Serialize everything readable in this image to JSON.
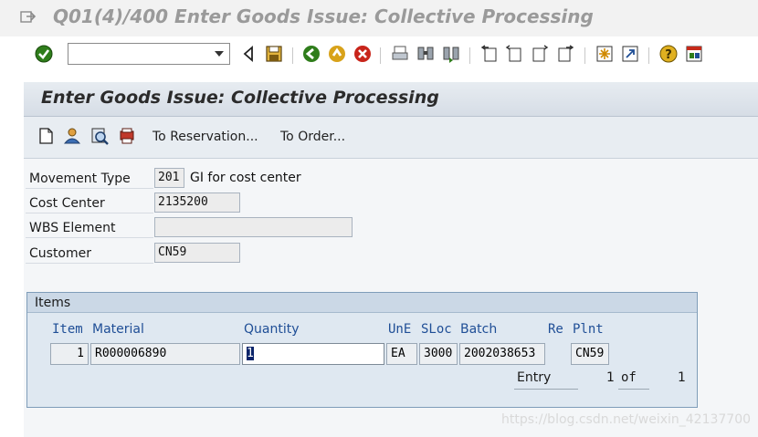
{
  "window": {
    "title": "Q01(4)/400 Enter Goods Issue: Collective Processing"
  },
  "toolbar": {
    "command_field_value": "",
    "buttons": [
      {
        "name": "enter-icon"
      },
      {
        "name": "back-arrow-icon"
      },
      {
        "name": "save-icon"
      },
      {
        "name": "back-icon"
      },
      {
        "name": "exit-icon"
      },
      {
        "name": "cancel-icon"
      },
      {
        "name": "print-icon"
      },
      {
        "name": "find-icon"
      },
      {
        "name": "find-next-icon"
      },
      {
        "name": "first-page-icon"
      },
      {
        "name": "previous-page-icon"
      },
      {
        "name": "next-page-icon"
      },
      {
        "name": "last-page-icon"
      },
      {
        "name": "create-session-icon"
      },
      {
        "name": "shortcut-icon"
      },
      {
        "name": "help-icon"
      },
      {
        "name": "layout-menu-icon"
      }
    ]
  },
  "screen": {
    "title": "Enter Goods Issue: Collective Processing"
  },
  "app_toolbar": {
    "icons": [
      {
        "name": "new-item-icon"
      },
      {
        "name": "user-icon"
      },
      {
        "name": "detail-search-icon"
      },
      {
        "name": "cancel-reservation-icon"
      }
    ],
    "to_reservation": "To Reservation...",
    "to_order": "To Order..."
  },
  "header": {
    "movement_type_label": "Movement Type",
    "movement_type_value": "201",
    "movement_type_text": "GI for cost center",
    "cost_center_label": "Cost Center",
    "cost_center_value": "2135200",
    "wbs_label": "WBS Element",
    "wbs_value": "",
    "customer_label": "Customer",
    "customer_value": "CN59"
  },
  "items": {
    "title": "Items",
    "columns": {
      "item": "Item",
      "material": "Material",
      "quantity": "Quantity",
      "une": "UnE",
      "sloc": "SLoc",
      "batch": "Batch",
      "re": "Re",
      "plnt": "Plnt"
    },
    "row": {
      "item": "1",
      "material": "R000006890",
      "quantity": "1",
      "une": "EA",
      "sloc": "3000",
      "batch": "2002038653",
      "plnt": "CN59"
    },
    "entry_label": "Entry",
    "entry_current": "1",
    "of_label": "of",
    "entry_total": "1"
  },
  "watermark": {
    "text": "https://blog.csdn.net/weixin_42137700"
  },
  "colors": {
    "title_gray": "#9a9a9a",
    "column_header_blue": "#1f4e96",
    "highlight_yellow": "#ffff00",
    "selection_navy": "#0a246a"
  }
}
